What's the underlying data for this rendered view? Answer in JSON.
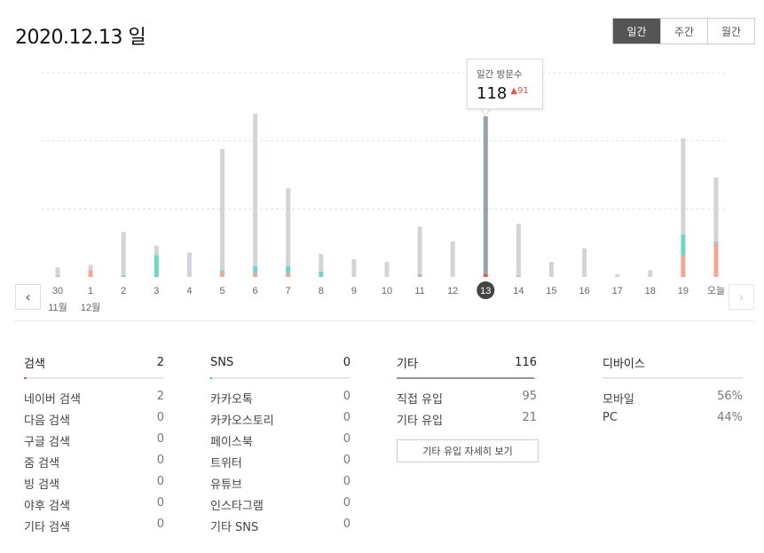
{
  "page": {
    "title": "2020.12.13 일"
  },
  "period_tabs": [
    {
      "label": "일간",
      "active": true
    },
    {
      "label": "주간",
      "active": false
    },
    {
      "label": "월간",
      "active": false
    }
  ],
  "tooltip": {
    "label": "일간 방문수",
    "value": "118",
    "delta": "91"
  },
  "chart_data": {
    "type": "bar",
    "categories": [
      "30",
      "1",
      "2",
      "3",
      "4",
      "5",
      "6",
      "7",
      "8",
      "9",
      "10",
      "11",
      "12",
      "13",
      "14",
      "15",
      "16",
      "17",
      "18",
      "19",
      "오늘"
    ],
    "month_labels": {
      "30": "11월",
      "1": "12월"
    },
    "selected": "13",
    "ylim": [
      0,
      150
    ],
    "series": [
      {
        "color": "#f0a796",
        "values": [
          1,
          5,
          0,
          0,
          0,
          4,
          3,
          3,
          0,
          0,
          0,
          1,
          0,
          2,
          1,
          0,
          0,
          0,
          0,
          16,
          25
        ]
      },
      {
        "color": "#6cd6c8",
        "values": [
          0,
          0,
          1,
          16,
          0,
          1,
          5,
          5,
          4,
          0,
          0,
          1,
          0,
          0,
          0,
          0,
          0,
          0,
          0,
          15,
          1
        ]
      },
      {
        "color": "#d1d4d8",
        "values": [
          6,
          4,
          32,
          7,
          18,
          89,
          112,
          57,
          13,
          13,
          11,
          35,
          26,
          116,
          38,
          11,
          21,
          2,
          5,
          71,
          47
        ]
      }
    ],
    "grid": true
  },
  "sections": [
    {
      "title": "검색",
      "total": "2",
      "accent": "#e8534a",
      "fill": 0.02,
      "rows": [
        {
          "label": "네이버 검색",
          "value": "2"
        },
        {
          "label": "다음 검색",
          "value": "0"
        },
        {
          "label": "구글 검색",
          "value": "0"
        },
        {
          "label": "줌 검색",
          "value": "0"
        },
        {
          "label": "빙 검색",
          "value": "0"
        },
        {
          "label": "야후 검색",
          "value": "0"
        },
        {
          "label": "기타 검색",
          "value": "0"
        }
      ]
    },
    {
      "title": "SNS",
      "total": "0",
      "accent": "#2fbfa9",
      "fill": 0.01,
      "rows": [
        {
          "label": "카카오톡",
          "value": "0"
        },
        {
          "label": "카카오스토리",
          "value": "0"
        },
        {
          "label": "페이스북",
          "value": "0"
        },
        {
          "label": "트위터",
          "value": "0"
        },
        {
          "label": "유튜브",
          "value": "0"
        },
        {
          "label": "인스타그램",
          "value": "0"
        },
        {
          "label": "기타 SNS",
          "value": "0"
        }
      ]
    },
    {
      "title": "기타",
      "total": "116",
      "accent": "#8f969d",
      "fill": 0.98,
      "rows": [
        {
          "label": "직접 유입",
          "value": "95"
        },
        {
          "label": "기타 유입",
          "value": "21"
        }
      ],
      "button": "기타 유입 자세히 보기"
    },
    {
      "title": "디바이스",
      "total": "",
      "accent": "#e6e6e6",
      "fill": 0,
      "rows": [
        {
          "label": "모바일",
          "value": "56%"
        },
        {
          "label": "PC",
          "value": "44%"
        }
      ]
    }
  ]
}
